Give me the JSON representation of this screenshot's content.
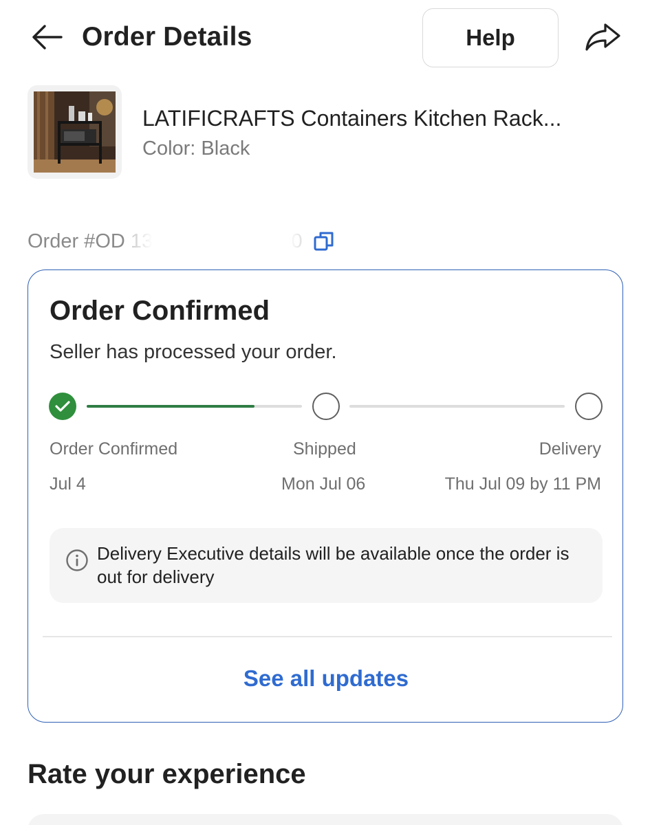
{
  "header": {
    "title": "Order Details",
    "help_label": "Help",
    "back_icon": "arrow-left-icon",
    "share_icon": "share-icon"
  },
  "product": {
    "name": "LATIFICRAFTS Containers Kitchen Rack...",
    "variant": "Color: Black",
    "thumbnail": "kitchen-rack-thumbnail"
  },
  "order": {
    "id_text": "Order #OD 1333 ··· ·· ·· ··· 400",
    "copy_icon": "copy-icon"
  },
  "status": {
    "title": "Order Confirmed",
    "subtitle": "Seller has processed your order.",
    "steps": [
      {
        "label": "Order Confirmed",
        "date": "Jul 4",
        "done": true
      },
      {
        "label": "Shipped",
        "date": "Mon Jul 06",
        "done": false
      },
      {
        "label": "Delivery",
        "date": "Thu Jul 09 by 11 PM",
        "done": false
      }
    ],
    "progress_fraction": 0.78,
    "info_text": "Delivery Executive details will be available once the order is out for delivery",
    "see_all_label": "See all updates"
  },
  "rate": {
    "title": "Rate your experience"
  },
  "colors": {
    "accent_blue": "#2f6bd0",
    "card_border": "#2d5fb5",
    "success_green": "#2f8f3c",
    "text_primary": "#212121",
    "text_secondary": "#7a7a7a"
  }
}
